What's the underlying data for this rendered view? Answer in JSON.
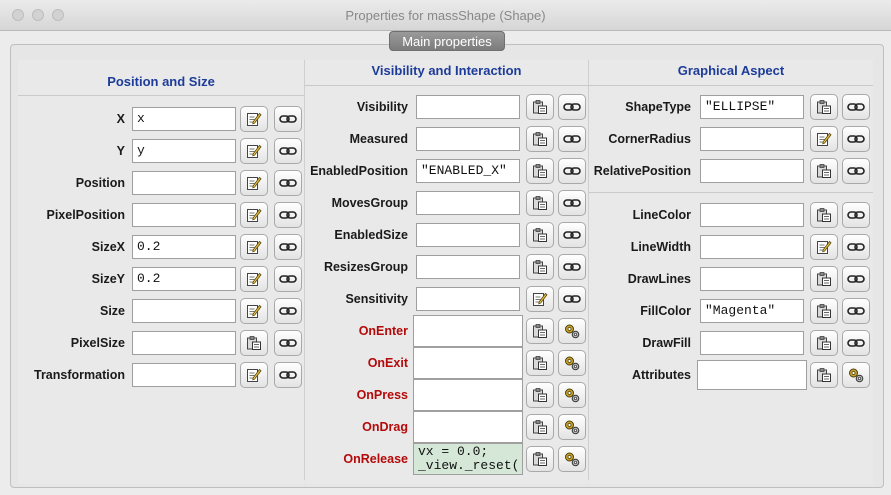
{
  "window": {
    "title": "Properties for massShape (Shape)"
  },
  "tab": {
    "label": "Main properties"
  },
  "info_icon": "i",
  "panels": {
    "position": {
      "title": "Position and Size",
      "rows": [
        {
          "label": "X",
          "value": "x",
          "edit": "edit-icon"
        },
        {
          "label": "Y",
          "value": "y",
          "edit": "edit-icon"
        },
        {
          "label": "Position",
          "value": "",
          "edit": "edit-icon"
        },
        {
          "label": "PixelPosition",
          "value": "",
          "edit": "edit-icon"
        },
        {
          "label": "SizeX",
          "value": "0.2",
          "edit": "edit-icon"
        },
        {
          "label": "SizeY",
          "value": "0.2",
          "edit": "edit-icon"
        },
        {
          "label": "Size",
          "value": "",
          "edit": "edit-icon"
        },
        {
          "label": "PixelSize",
          "value": "",
          "edit": "clipboard-icon"
        },
        {
          "label": "Transformation",
          "value": "",
          "edit": "edit-icon"
        }
      ]
    },
    "visibility": {
      "title": "Visibility and Interaction",
      "rows": [
        {
          "label": "Visibility",
          "value": "",
          "edit": "clipboard-icon",
          "action": "link-icon"
        },
        {
          "label": "Measured",
          "value": "",
          "edit": "clipboard-icon",
          "action": "link-icon"
        },
        {
          "label": "EnabledPosition",
          "value": "\"ENABLED_X\"",
          "edit": "clipboard-icon",
          "action": "link-icon"
        },
        {
          "label": "MovesGroup",
          "value": "",
          "edit": "clipboard-icon",
          "action": "link-icon"
        },
        {
          "label": "EnabledSize",
          "value": "",
          "edit": "clipboard-icon",
          "action": "link-icon"
        },
        {
          "label": "ResizesGroup",
          "value": "",
          "edit": "clipboard-icon",
          "action": "link-icon"
        },
        {
          "label": "Sensitivity",
          "value": "",
          "edit": "edit-icon",
          "action": "link-icon"
        },
        {
          "label": "OnEnter",
          "value": "",
          "edit": "clipboard-icon",
          "action": "gears-icon",
          "event": true
        },
        {
          "label": "OnExit",
          "value": "",
          "edit": "clipboard-icon",
          "action": "gears-icon",
          "event": true
        },
        {
          "label": "OnPress",
          "value": "",
          "edit": "clipboard-icon",
          "action": "gears-icon",
          "event": true
        },
        {
          "label": "OnDrag",
          "value": "",
          "edit": "clipboard-icon",
          "action": "gears-icon",
          "event": true
        },
        {
          "label": "OnRelease",
          "value": "vx = 0.0;\n_view._reset(",
          "edit": "clipboard-icon",
          "action": "gears-icon",
          "event": true
        }
      ]
    },
    "graphical": {
      "title": "Graphical Aspect",
      "rows": [
        {
          "label": "ShapeType",
          "value": "\"ELLIPSE\"",
          "edit": "clipboard-icon",
          "action": "link-icon"
        },
        {
          "label": "CornerRadius",
          "value": "",
          "edit": "edit-icon",
          "action": "link-icon"
        },
        {
          "label": "RelativePosition",
          "value": "",
          "edit": "clipboard-icon",
          "action": "link-icon"
        },
        {
          "label": "LineColor",
          "value": "",
          "edit": "clipboard-icon",
          "action": "link-icon"
        },
        {
          "label": "LineWidth",
          "value": "",
          "edit": "edit-icon",
          "action": "link-icon"
        },
        {
          "label": "DrawLines",
          "value": "",
          "edit": "clipboard-icon",
          "action": "link-icon"
        },
        {
          "label": "FillColor",
          "value": "\"Magenta\"",
          "edit": "clipboard-icon",
          "action": "link-icon"
        },
        {
          "label": "DrawFill",
          "value": "",
          "edit": "clipboard-icon",
          "action": "link-icon"
        },
        {
          "label": "Attributes",
          "value": "",
          "edit": "clipboard-icon",
          "action": "gears-icon"
        }
      ]
    }
  },
  "colors": {
    "heading": "#1d3c9a",
    "event_label": "#b40a0a",
    "code_bg": "#d5e8d7"
  }
}
